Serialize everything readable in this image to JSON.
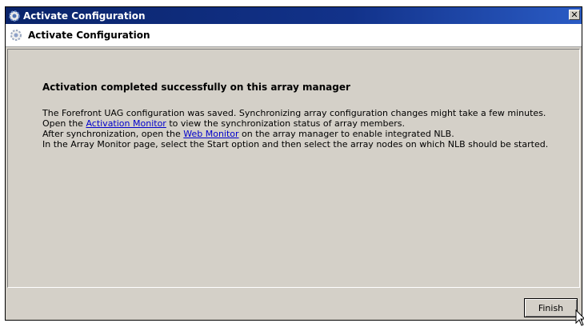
{
  "window": {
    "title": "Activate Configuration",
    "close_label": "✕"
  },
  "header": {
    "title": "Activate Configuration"
  },
  "content": {
    "heading": "Activation completed successfully on this array manager",
    "line1": "The Forefront UAG configuration was saved. Synchronizing array configuration changes might take a few minutes.",
    "line2_pre": "Open the ",
    "line2_link": "Activation Monitor",
    "line2_post": " to view the synchronization status of array members.",
    "line3_pre": "After synchronization, open the ",
    "line3_link": "Web Monitor",
    "line3_post": " on the array manager to enable integrated NLB.",
    "line4": "In the Array Monitor page, select the Start option and then select the array nodes on which NLB should be started."
  },
  "footer": {
    "finish_label": "Finish"
  },
  "icons": {
    "title_icon": "gear-icon",
    "header_icon": "gear-icon",
    "cursor": "mouse-cursor-icon"
  },
  "colors": {
    "titlebar": "#0a246a",
    "link": "#0000cc",
    "dialog_bg": "#d4d0c8"
  }
}
